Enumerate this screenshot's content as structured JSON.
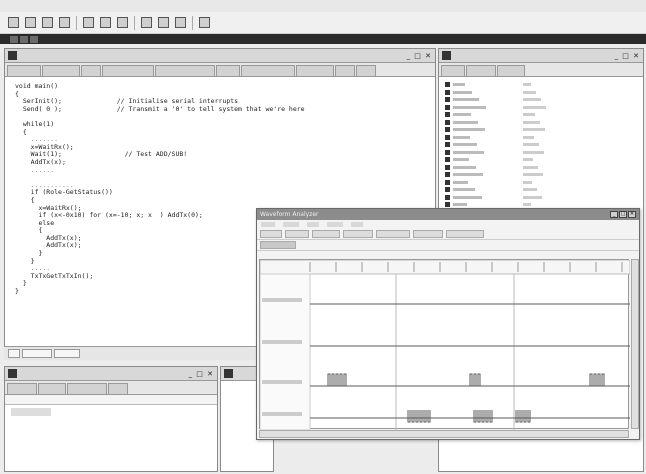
{
  "editor": {
    "tabs": [
      "",
      "",
      "",
      "",
      "",
      "",
      "",
      "",
      "",
      ""
    ],
    "code_lines": [
      {
        "text": "void main()",
        "dim": false
      },
      {
        "text": "{",
        "dim": false
      },
      {
        "text": "  SerInit();              // Initialise serial interrupts",
        "dim": false
      },
      {
        "text": "  Send( 0 );              // Transmit a '0' to tell system that we're here",
        "dim": false
      },
      {
        "text": "",
        "dim": false
      },
      {
        "text": "  while(1)",
        "dim": false
      },
      {
        "text": "  {",
        "dim": false
      },
      {
        "text": "    .......",
        "dim": true
      },
      {
        "text": "    x=WaitRx();",
        "dim": false
      },
      {
        "text": "    Wait(1);                // Test ADD/SUB!",
        "dim": false
      },
      {
        "text": "    AddTx(x);",
        "dim": false
      },
      {
        "text": "    ......",
        "dim": true
      },
      {
        "text": "",
        "dim": false
      },
      {
        "text": "    ...........",
        "dim": true
      },
      {
        "text": "    if (Role-GetStatus())",
        "dim": false
      },
      {
        "text": "    {",
        "dim": false
      },
      {
        "text": "      x=WaitRx();",
        "dim": false
      },
      {
        "text": "      if (x<-0x10) for (x=-10; x; x  ) AddTx(0);",
        "dim": false
      },
      {
        "text": "      else",
        "dim": false
      },
      {
        "text": "      {",
        "dim": false
      },
      {
        "text": "        AddTx(x);",
        "dim": false
      },
      {
        "text": "        AddTx(x);",
        "dim": false
      },
      {
        "text": "      }",
        "dim": false
      },
      {
        "text": "    }",
        "dim": false
      },
      {
        "text": "    .....",
        "dim": true
      },
      {
        "text": "    TxTxGetTxTxIn();",
        "dim": false
      },
      {
        "text": "  }",
        "dim": false
      },
      {
        "text": "}",
        "dim": false
      },
      {
        "text": "",
        "dim": false
      },
      {
        "text": "",
        "dim": false
      },
      {
        "text": "",
        "dim": false
      }
    ],
    "status_tabs": [
      "",
      "",
      ""
    ]
  },
  "right_panel": {
    "tabs": [
      "",
      "",
      ""
    ]
  },
  "waveform": {
    "title": "Waveform Analyzer",
    "channel_labels": [
      "",
      "",
      "",
      ""
    ],
    "menu": [
      "",
      "",
      "",
      "",
      ""
    ]
  },
  "colors": {
    "background": "#ececec",
    "window_border": "#8a8a8a",
    "waveform_trace": "#5a5a5a"
  }
}
